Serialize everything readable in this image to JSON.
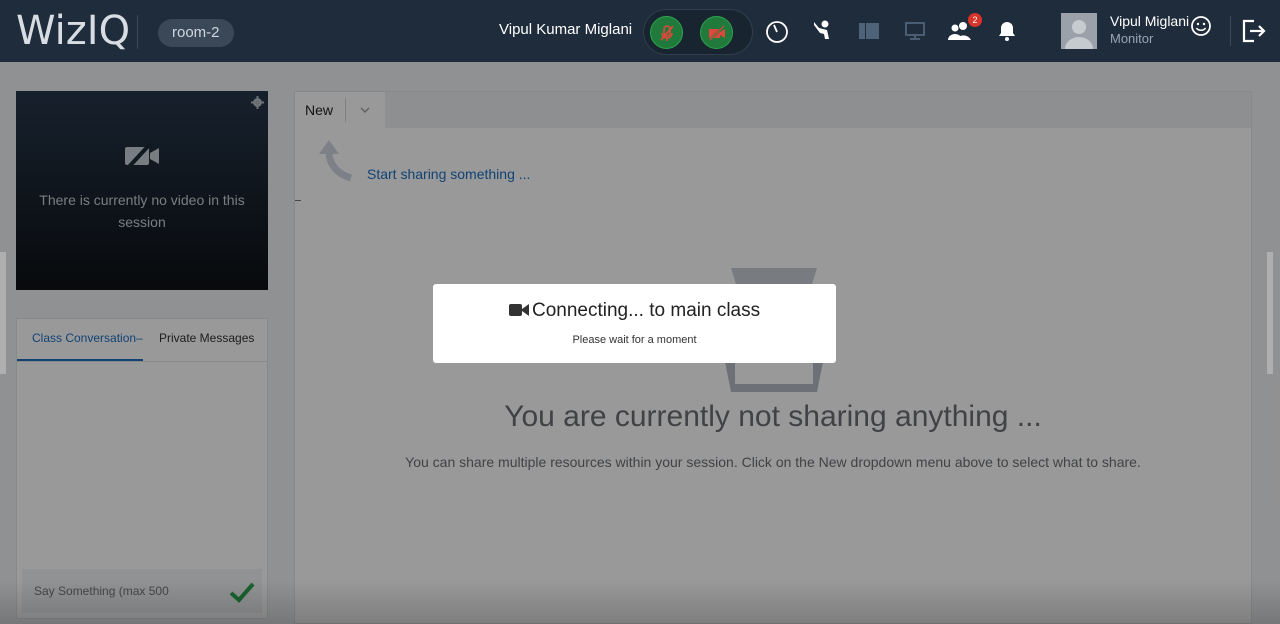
{
  "header": {
    "logo": "WizIQ",
    "room": "room-2",
    "host_name": "Vipul Kumar Miglani",
    "user_name": "Vipul Miglani",
    "user_role": "Monitor",
    "attendee_badge": "2",
    "icons": [
      "mic-muted-icon",
      "camera-muted-icon",
      "timer-icon",
      "raise-hand-icon",
      "layout-icon",
      "screen-share-icon",
      "attendees-icon",
      "bell-icon",
      "smiley-icon",
      "exit-icon"
    ]
  },
  "video": {
    "message": "There is currently no video in this session"
  },
  "chat": {
    "tab_class": "Class Conversation–",
    "tab_private": "Private Messages",
    "input_placeholder": "Say Something (max 500"
  },
  "share": {
    "new_tab": "New",
    "start_hint": "Start sharing something ...",
    "heading": "You are currently not sharing anything ...",
    "tip": "You can share multiple resources within your session. Click on the New dropdown menu above to select what to share."
  },
  "modal": {
    "title": "Connecting... to main class",
    "subtitle": "Please wait for a moment"
  },
  "colors": {
    "header_bg": "#1f2c3b",
    "accent": "#1f6fc2",
    "media_green": "#1f7a3b",
    "mute_red": "#d9342b",
    "send_green": "#2ea44f"
  }
}
